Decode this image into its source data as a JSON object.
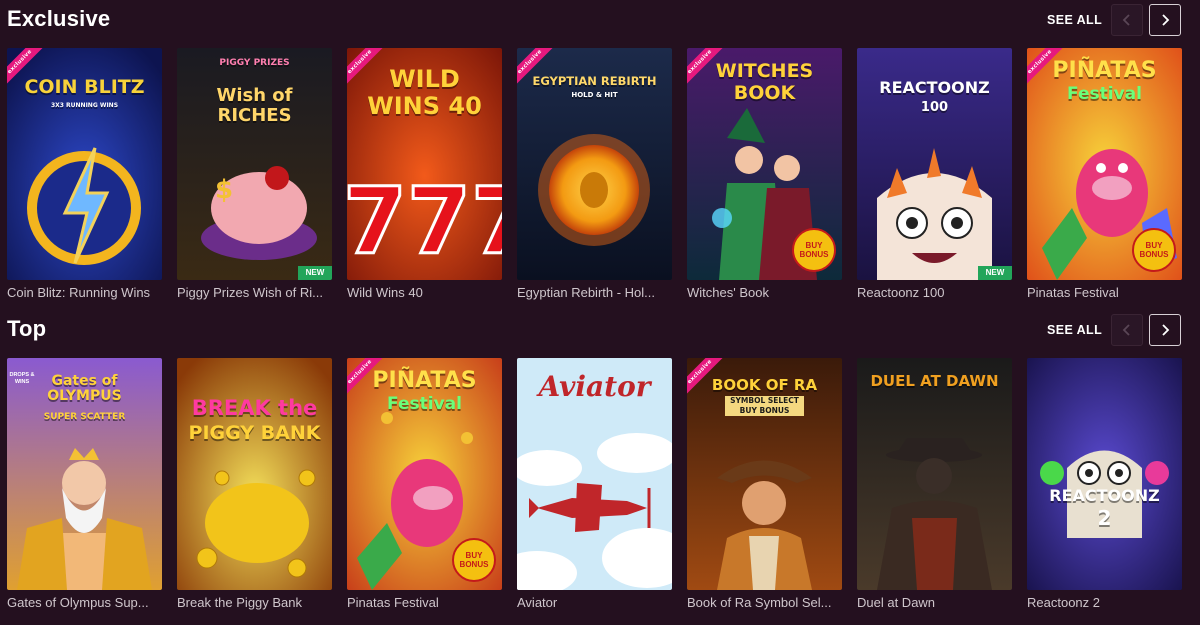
{
  "sections": [
    {
      "title": "Exclusive",
      "see_all": "SEE ALL",
      "games": [
        {
          "name": "Coin Blitz: Running Wins",
          "art_text": "COIN BLITZ",
          "art_sub": "3X3 RUNNING WINS",
          "exclusive": "exclusive"
        },
        {
          "name": "Piggy Prizes Wish of Ri...",
          "art_text": "Wish of RICHES",
          "art_sub": "PIGGY PRIZES",
          "new": "NEW"
        },
        {
          "name": "Wild Wins 40",
          "art_text": "WILD WINS 40",
          "exclusive": "exclusive"
        },
        {
          "name": "Egyptian Rebirth - Hol...",
          "art_text": "EGYPTIAN REBIRTH",
          "art_sub": "HOLD & HIT",
          "exclusive": "exclusive"
        },
        {
          "name": "Witches' Book",
          "art_text": "WITCHES BOOK",
          "exclusive": "exclusive",
          "buy": "BUY BONUS"
        },
        {
          "name": "Reactoonz 100",
          "art_text": "REACTOONZ",
          "art_sub": "100",
          "new": "NEW"
        },
        {
          "name": "Pinatas Festival",
          "art_text": "PIÑATAS",
          "art_sub": "Festival",
          "exclusive": "exclusive",
          "buy": "BUY BONUS"
        }
      ]
    },
    {
      "title": "Top",
      "see_all": "SEE ALL",
      "games": [
        {
          "name": "Gates of Olympus Sup...",
          "art_text": "Gates of OLYMPUS",
          "art_sub": "SUPER SCATTER",
          "corner": "DROPS & WINS"
        },
        {
          "name": "Break the Piggy Bank",
          "art_text": "BREAK the",
          "art_sub": "PIGGY BANK"
        },
        {
          "name": "Pinatas Festival",
          "art_text": "PIÑATAS",
          "art_sub": "Festival",
          "exclusive": "exclusive",
          "buy": "BUY BONUS"
        },
        {
          "name": "Aviator",
          "art_text": "Aviator"
        },
        {
          "name": "Book of Ra Symbol Sel...",
          "art_text": "BOOK OF RA",
          "art_sub": "SYMBOL SELECT BUY BONUS",
          "exclusive": "exclusive"
        },
        {
          "name": "Duel at Dawn",
          "art_text": "DUEL AT DAWN"
        },
        {
          "name": "Reactoonz 2",
          "art_text": "REACTOONZ",
          "art_sub": "2"
        }
      ]
    }
  ],
  "colors": {
    "background": "#24101f",
    "label": "#cfc6cc",
    "exclusive_badge": "#e6197e",
    "new_badge": "#22a55a"
  }
}
